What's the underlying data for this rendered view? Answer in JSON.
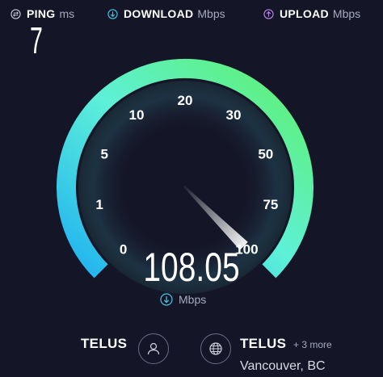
{
  "metrics": {
    "ping": {
      "label": "PING",
      "unit": "ms",
      "icon": "ping-icon",
      "color": "#c9cbd8"
    },
    "download": {
      "label": "DOWNLOAD",
      "unit": "Mbps",
      "icon": "download-icon",
      "color": "#45c6e6"
    },
    "upload": {
      "label": "UPLOAD",
      "unit": "Mbps",
      "icon": "upload-icon",
      "color": "#bb86f0"
    }
  },
  "ping_value": "7",
  "gauge": {
    "ticks": [
      "0",
      "1",
      "5",
      "10",
      "20",
      "30",
      "50",
      "75",
      "100"
    ],
    "needle_value": 100,
    "arc_colors": {
      "start": "#1fb1f0",
      "mid": "#5ef0d8",
      "end": "#5ff06a"
    }
  },
  "speed": {
    "value": "108.05",
    "unit": "Mbps",
    "icon": "download-icon"
  },
  "isp": {
    "name": "TELUS",
    "icon": "user-icon"
  },
  "server": {
    "name": "TELUS",
    "more": "+ 3 more",
    "location": "Vancouver, BC",
    "icon": "globe-icon"
  }
}
